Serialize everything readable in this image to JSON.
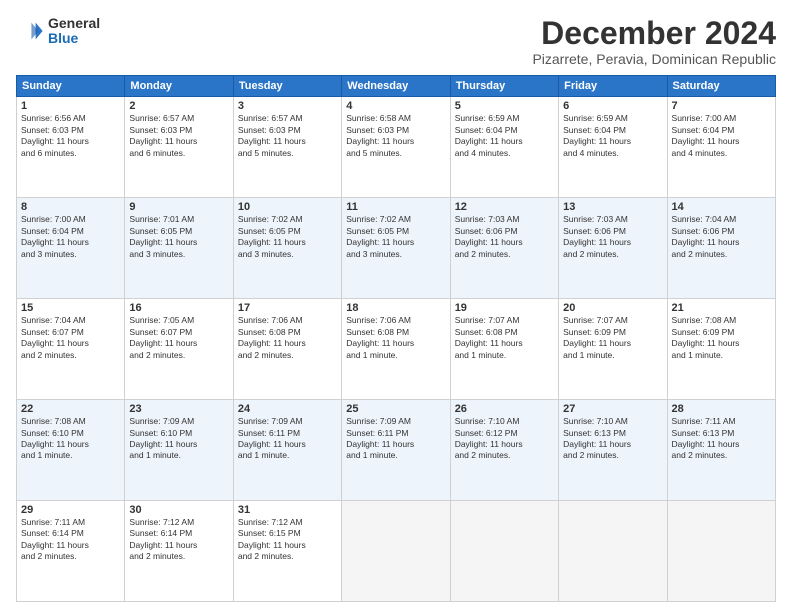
{
  "header": {
    "logo_general": "General",
    "logo_blue": "Blue",
    "month_title": "December 2024",
    "location": "Pizarrete, Peravia, Dominican Republic"
  },
  "weekdays": [
    "Sunday",
    "Monday",
    "Tuesday",
    "Wednesday",
    "Thursday",
    "Friday",
    "Saturday"
  ],
  "weeks": [
    [
      {
        "day": "1",
        "info": "Sunrise: 6:56 AM\nSunset: 6:03 PM\nDaylight: 11 hours\nand 6 minutes."
      },
      {
        "day": "2",
        "info": "Sunrise: 6:57 AM\nSunset: 6:03 PM\nDaylight: 11 hours\nand 6 minutes."
      },
      {
        "day": "3",
        "info": "Sunrise: 6:57 AM\nSunset: 6:03 PM\nDaylight: 11 hours\nand 5 minutes."
      },
      {
        "day": "4",
        "info": "Sunrise: 6:58 AM\nSunset: 6:03 PM\nDaylight: 11 hours\nand 5 minutes."
      },
      {
        "day": "5",
        "info": "Sunrise: 6:59 AM\nSunset: 6:04 PM\nDaylight: 11 hours\nand 4 minutes."
      },
      {
        "day": "6",
        "info": "Sunrise: 6:59 AM\nSunset: 6:04 PM\nDaylight: 11 hours\nand 4 minutes."
      },
      {
        "day": "7",
        "info": "Sunrise: 7:00 AM\nSunset: 6:04 PM\nDaylight: 11 hours\nand 4 minutes."
      }
    ],
    [
      {
        "day": "8",
        "info": "Sunrise: 7:00 AM\nSunset: 6:04 PM\nDaylight: 11 hours\nand 3 minutes."
      },
      {
        "day": "9",
        "info": "Sunrise: 7:01 AM\nSunset: 6:05 PM\nDaylight: 11 hours\nand 3 minutes."
      },
      {
        "day": "10",
        "info": "Sunrise: 7:02 AM\nSunset: 6:05 PM\nDaylight: 11 hours\nand 3 minutes."
      },
      {
        "day": "11",
        "info": "Sunrise: 7:02 AM\nSunset: 6:05 PM\nDaylight: 11 hours\nand 3 minutes."
      },
      {
        "day": "12",
        "info": "Sunrise: 7:03 AM\nSunset: 6:06 PM\nDaylight: 11 hours\nand 2 minutes."
      },
      {
        "day": "13",
        "info": "Sunrise: 7:03 AM\nSunset: 6:06 PM\nDaylight: 11 hours\nand 2 minutes."
      },
      {
        "day": "14",
        "info": "Sunrise: 7:04 AM\nSunset: 6:06 PM\nDaylight: 11 hours\nand 2 minutes."
      }
    ],
    [
      {
        "day": "15",
        "info": "Sunrise: 7:04 AM\nSunset: 6:07 PM\nDaylight: 11 hours\nand 2 minutes."
      },
      {
        "day": "16",
        "info": "Sunrise: 7:05 AM\nSunset: 6:07 PM\nDaylight: 11 hours\nand 2 minutes."
      },
      {
        "day": "17",
        "info": "Sunrise: 7:06 AM\nSunset: 6:08 PM\nDaylight: 11 hours\nand 2 minutes."
      },
      {
        "day": "18",
        "info": "Sunrise: 7:06 AM\nSunset: 6:08 PM\nDaylight: 11 hours\nand 1 minute."
      },
      {
        "day": "19",
        "info": "Sunrise: 7:07 AM\nSunset: 6:08 PM\nDaylight: 11 hours\nand 1 minute."
      },
      {
        "day": "20",
        "info": "Sunrise: 7:07 AM\nSunset: 6:09 PM\nDaylight: 11 hours\nand 1 minute."
      },
      {
        "day": "21",
        "info": "Sunrise: 7:08 AM\nSunset: 6:09 PM\nDaylight: 11 hours\nand 1 minute."
      }
    ],
    [
      {
        "day": "22",
        "info": "Sunrise: 7:08 AM\nSunset: 6:10 PM\nDaylight: 11 hours\nand 1 minute."
      },
      {
        "day": "23",
        "info": "Sunrise: 7:09 AM\nSunset: 6:10 PM\nDaylight: 11 hours\nand 1 minute."
      },
      {
        "day": "24",
        "info": "Sunrise: 7:09 AM\nSunset: 6:11 PM\nDaylight: 11 hours\nand 1 minute."
      },
      {
        "day": "25",
        "info": "Sunrise: 7:09 AM\nSunset: 6:11 PM\nDaylight: 11 hours\nand 1 minute."
      },
      {
        "day": "26",
        "info": "Sunrise: 7:10 AM\nSunset: 6:12 PM\nDaylight: 11 hours\nand 2 minutes."
      },
      {
        "day": "27",
        "info": "Sunrise: 7:10 AM\nSunset: 6:13 PM\nDaylight: 11 hours\nand 2 minutes."
      },
      {
        "day": "28",
        "info": "Sunrise: 7:11 AM\nSunset: 6:13 PM\nDaylight: 11 hours\nand 2 minutes."
      }
    ],
    [
      {
        "day": "29",
        "info": "Sunrise: 7:11 AM\nSunset: 6:14 PM\nDaylight: 11 hours\nand 2 minutes."
      },
      {
        "day": "30",
        "info": "Sunrise: 7:12 AM\nSunset: 6:14 PM\nDaylight: 11 hours\nand 2 minutes."
      },
      {
        "day": "31",
        "info": "Sunrise: 7:12 AM\nSunset: 6:15 PM\nDaylight: 11 hours\nand 2 minutes."
      },
      null,
      null,
      null,
      null
    ]
  ]
}
